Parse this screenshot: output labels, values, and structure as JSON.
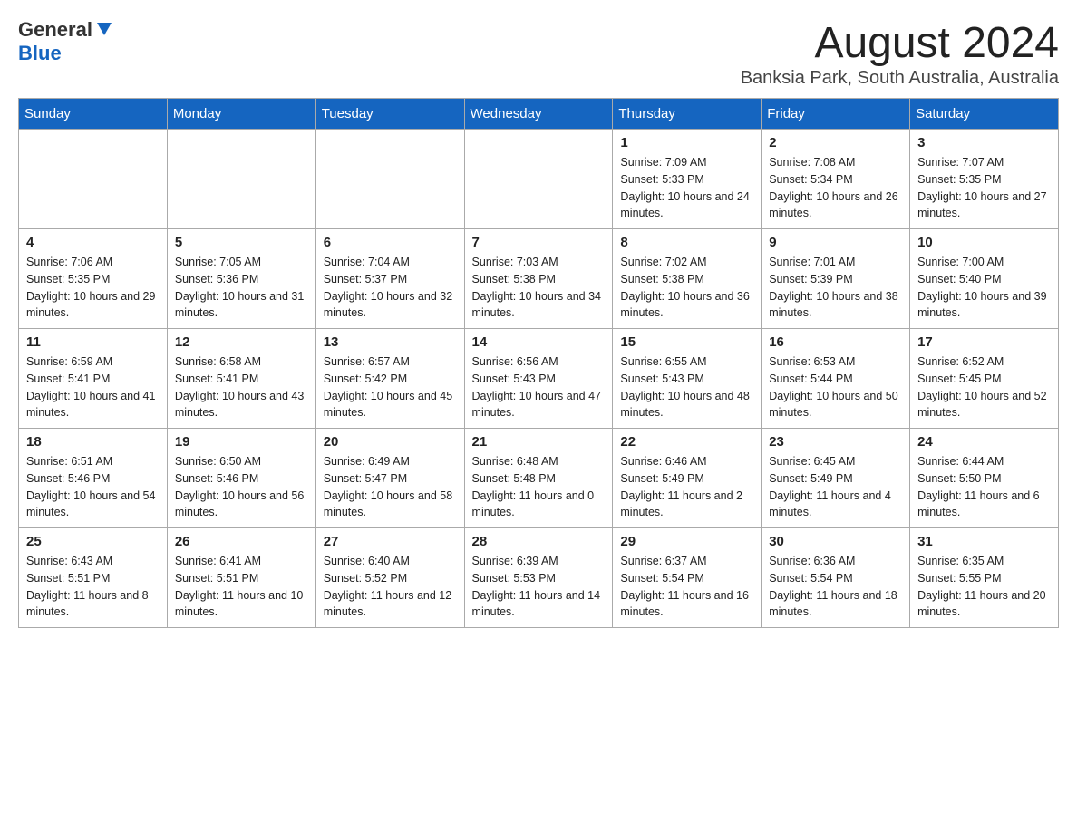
{
  "header": {
    "logo_general": "General",
    "logo_blue": "Blue",
    "month_title": "August 2024",
    "location": "Banksia Park, South Australia, Australia"
  },
  "days_of_week": [
    "Sunday",
    "Monday",
    "Tuesday",
    "Wednesday",
    "Thursday",
    "Friday",
    "Saturday"
  ],
  "weeks": [
    [
      {
        "day": "",
        "sunrise": "",
        "sunset": "",
        "daylight": ""
      },
      {
        "day": "",
        "sunrise": "",
        "sunset": "",
        "daylight": ""
      },
      {
        "day": "",
        "sunrise": "",
        "sunset": "",
        "daylight": ""
      },
      {
        "day": "",
        "sunrise": "",
        "sunset": "",
        "daylight": ""
      },
      {
        "day": "1",
        "sunrise": "Sunrise: 7:09 AM",
        "sunset": "Sunset: 5:33 PM",
        "daylight": "Daylight: 10 hours and 24 minutes."
      },
      {
        "day": "2",
        "sunrise": "Sunrise: 7:08 AM",
        "sunset": "Sunset: 5:34 PM",
        "daylight": "Daylight: 10 hours and 26 minutes."
      },
      {
        "day": "3",
        "sunrise": "Sunrise: 7:07 AM",
        "sunset": "Sunset: 5:35 PM",
        "daylight": "Daylight: 10 hours and 27 minutes."
      }
    ],
    [
      {
        "day": "4",
        "sunrise": "Sunrise: 7:06 AM",
        "sunset": "Sunset: 5:35 PM",
        "daylight": "Daylight: 10 hours and 29 minutes."
      },
      {
        "day": "5",
        "sunrise": "Sunrise: 7:05 AM",
        "sunset": "Sunset: 5:36 PM",
        "daylight": "Daylight: 10 hours and 31 minutes."
      },
      {
        "day": "6",
        "sunrise": "Sunrise: 7:04 AM",
        "sunset": "Sunset: 5:37 PM",
        "daylight": "Daylight: 10 hours and 32 minutes."
      },
      {
        "day": "7",
        "sunrise": "Sunrise: 7:03 AM",
        "sunset": "Sunset: 5:38 PM",
        "daylight": "Daylight: 10 hours and 34 minutes."
      },
      {
        "day": "8",
        "sunrise": "Sunrise: 7:02 AM",
        "sunset": "Sunset: 5:38 PM",
        "daylight": "Daylight: 10 hours and 36 minutes."
      },
      {
        "day": "9",
        "sunrise": "Sunrise: 7:01 AM",
        "sunset": "Sunset: 5:39 PM",
        "daylight": "Daylight: 10 hours and 38 minutes."
      },
      {
        "day": "10",
        "sunrise": "Sunrise: 7:00 AM",
        "sunset": "Sunset: 5:40 PM",
        "daylight": "Daylight: 10 hours and 39 minutes."
      }
    ],
    [
      {
        "day": "11",
        "sunrise": "Sunrise: 6:59 AM",
        "sunset": "Sunset: 5:41 PM",
        "daylight": "Daylight: 10 hours and 41 minutes."
      },
      {
        "day": "12",
        "sunrise": "Sunrise: 6:58 AM",
        "sunset": "Sunset: 5:41 PM",
        "daylight": "Daylight: 10 hours and 43 minutes."
      },
      {
        "day": "13",
        "sunrise": "Sunrise: 6:57 AM",
        "sunset": "Sunset: 5:42 PM",
        "daylight": "Daylight: 10 hours and 45 minutes."
      },
      {
        "day": "14",
        "sunrise": "Sunrise: 6:56 AM",
        "sunset": "Sunset: 5:43 PM",
        "daylight": "Daylight: 10 hours and 47 minutes."
      },
      {
        "day": "15",
        "sunrise": "Sunrise: 6:55 AM",
        "sunset": "Sunset: 5:43 PM",
        "daylight": "Daylight: 10 hours and 48 minutes."
      },
      {
        "day": "16",
        "sunrise": "Sunrise: 6:53 AM",
        "sunset": "Sunset: 5:44 PM",
        "daylight": "Daylight: 10 hours and 50 minutes."
      },
      {
        "day": "17",
        "sunrise": "Sunrise: 6:52 AM",
        "sunset": "Sunset: 5:45 PM",
        "daylight": "Daylight: 10 hours and 52 minutes."
      }
    ],
    [
      {
        "day": "18",
        "sunrise": "Sunrise: 6:51 AM",
        "sunset": "Sunset: 5:46 PM",
        "daylight": "Daylight: 10 hours and 54 minutes."
      },
      {
        "day": "19",
        "sunrise": "Sunrise: 6:50 AM",
        "sunset": "Sunset: 5:46 PM",
        "daylight": "Daylight: 10 hours and 56 minutes."
      },
      {
        "day": "20",
        "sunrise": "Sunrise: 6:49 AM",
        "sunset": "Sunset: 5:47 PM",
        "daylight": "Daylight: 10 hours and 58 minutes."
      },
      {
        "day": "21",
        "sunrise": "Sunrise: 6:48 AM",
        "sunset": "Sunset: 5:48 PM",
        "daylight": "Daylight: 11 hours and 0 minutes."
      },
      {
        "day": "22",
        "sunrise": "Sunrise: 6:46 AM",
        "sunset": "Sunset: 5:49 PM",
        "daylight": "Daylight: 11 hours and 2 minutes."
      },
      {
        "day": "23",
        "sunrise": "Sunrise: 6:45 AM",
        "sunset": "Sunset: 5:49 PM",
        "daylight": "Daylight: 11 hours and 4 minutes."
      },
      {
        "day": "24",
        "sunrise": "Sunrise: 6:44 AM",
        "sunset": "Sunset: 5:50 PM",
        "daylight": "Daylight: 11 hours and 6 minutes."
      }
    ],
    [
      {
        "day": "25",
        "sunrise": "Sunrise: 6:43 AM",
        "sunset": "Sunset: 5:51 PM",
        "daylight": "Daylight: 11 hours and 8 minutes."
      },
      {
        "day": "26",
        "sunrise": "Sunrise: 6:41 AM",
        "sunset": "Sunset: 5:51 PM",
        "daylight": "Daylight: 11 hours and 10 minutes."
      },
      {
        "day": "27",
        "sunrise": "Sunrise: 6:40 AM",
        "sunset": "Sunset: 5:52 PM",
        "daylight": "Daylight: 11 hours and 12 minutes."
      },
      {
        "day": "28",
        "sunrise": "Sunrise: 6:39 AM",
        "sunset": "Sunset: 5:53 PM",
        "daylight": "Daylight: 11 hours and 14 minutes."
      },
      {
        "day": "29",
        "sunrise": "Sunrise: 6:37 AM",
        "sunset": "Sunset: 5:54 PM",
        "daylight": "Daylight: 11 hours and 16 minutes."
      },
      {
        "day": "30",
        "sunrise": "Sunrise: 6:36 AM",
        "sunset": "Sunset: 5:54 PM",
        "daylight": "Daylight: 11 hours and 18 minutes."
      },
      {
        "day": "31",
        "sunrise": "Sunrise: 6:35 AM",
        "sunset": "Sunset: 5:55 PM",
        "daylight": "Daylight: 11 hours and 20 minutes."
      }
    ]
  ]
}
